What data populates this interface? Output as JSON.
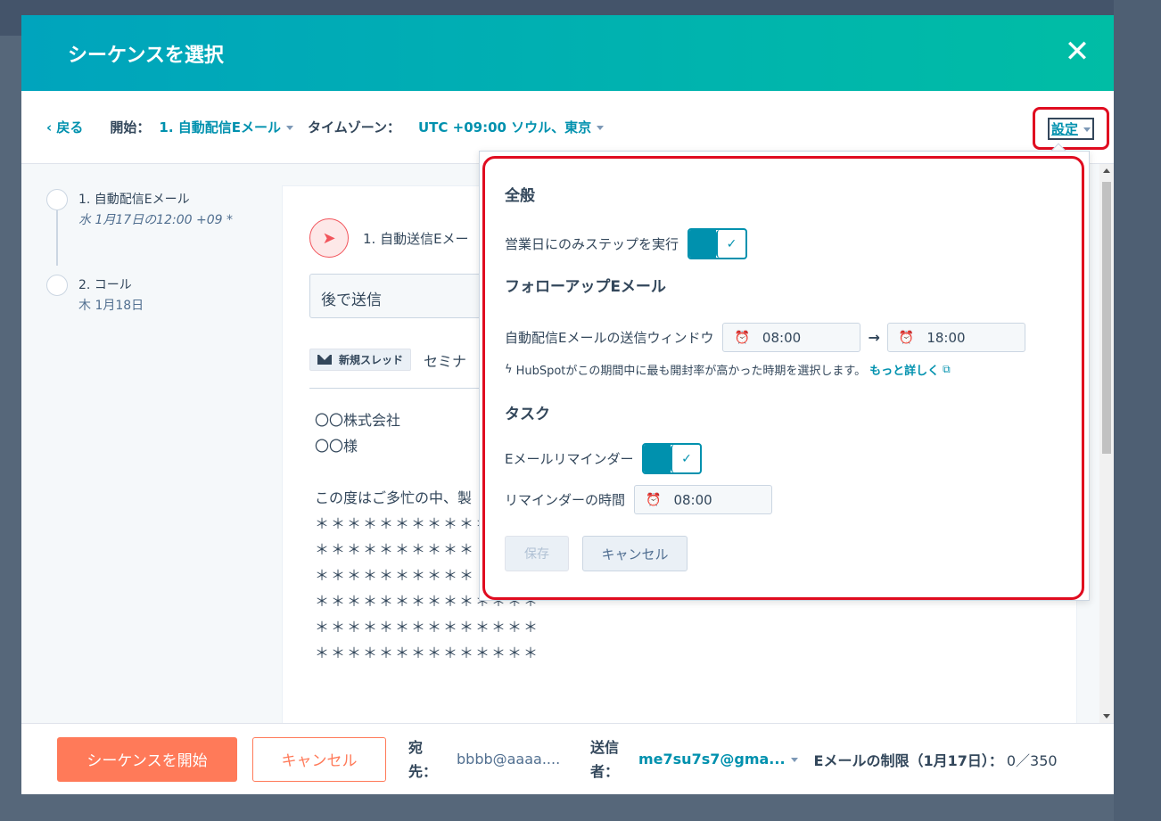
{
  "modal": {
    "title": "シーケンスを選択",
    "close_glyph": "✕"
  },
  "toolbar": {
    "back": "‹ 戻る",
    "start_label": "開始：",
    "start_value": "1. 自動配信Eメール",
    "timezone_label": "タイムゾーン：",
    "timezone_value": "UTC +09:00 ソウル、東京",
    "settings": "設定"
  },
  "steps": [
    {
      "title": "1. 自動配信Eメール",
      "date": "水 1月17日の12:00 +09 *"
    },
    {
      "title": "2. コール",
      "date": "木 1月18日"
    }
  ],
  "email": {
    "head_title": "1. 自動送信Eメー",
    "send_mode": "後で送信",
    "thread_badge": "新規スレッド",
    "subject": "セミナ",
    "body_lines": [
      "〇〇株式会社",
      "〇〇様"
    ],
    "intro": "この度はご多忙の中、製",
    "stars": [
      "＊＊＊＊＊＊＊＊＊＊＊",
      "＊＊＊＊＊＊＊＊＊＊",
      "＊＊＊＊＊＊＊＊＊＊",
      "＊＊＊＊＊＊＊＊＊＊＊＊＊＊",
      "＊＊＊＊＊＊＊＊＊＊＊＊＊＊",
      "＊＊＊＊＊＊＊＊＊＊＊＊＊＊"
    ]
  },
  "settings_popover": {
    "general_title": "全般",
    "business_days_label": "営業日にのみステップを実行",
    "business_days_on": true,
    "followup_title": "フォローアップEメール",
    "window_label": "自動配信Eメールの送信ウィンドウ",
    "window_start": "08:00",
    "window_end": "18:00",
    "window_arrow": "→",
    "hint": "HubSpotがこの期間中に最も開封率が高かった時期を選択します。",
    "hint_link": "もっと詳しく",
    "task_title": "タスク",
    "reminder_label": "Eメールリマインダー",
    "reminder_on": true,
    "reminder_time_label": "リマインダーの時間",
    "reminder_time": "08:00",
    "save": "保存",
    "cancel": "キャンセル"
  },
  "footer": {
    "start_button": "シーケンスを開始",
    "cancel_button": "キャンセル",
    "to_label": "宛先：",
    "to_value": "bbbb@aaaa....",
    "from_label": "送信者：",
    "from_value": "me7su7s7@gma...",
    "limit_label": "Eメールの制限（1月17日）：",
    "limit_value": "0／350"
  },
  "colors": {
    "accent": "#0091ae",
    "cta": "#ff7a59",
    "highlight": "#e00c20"
  }
}
